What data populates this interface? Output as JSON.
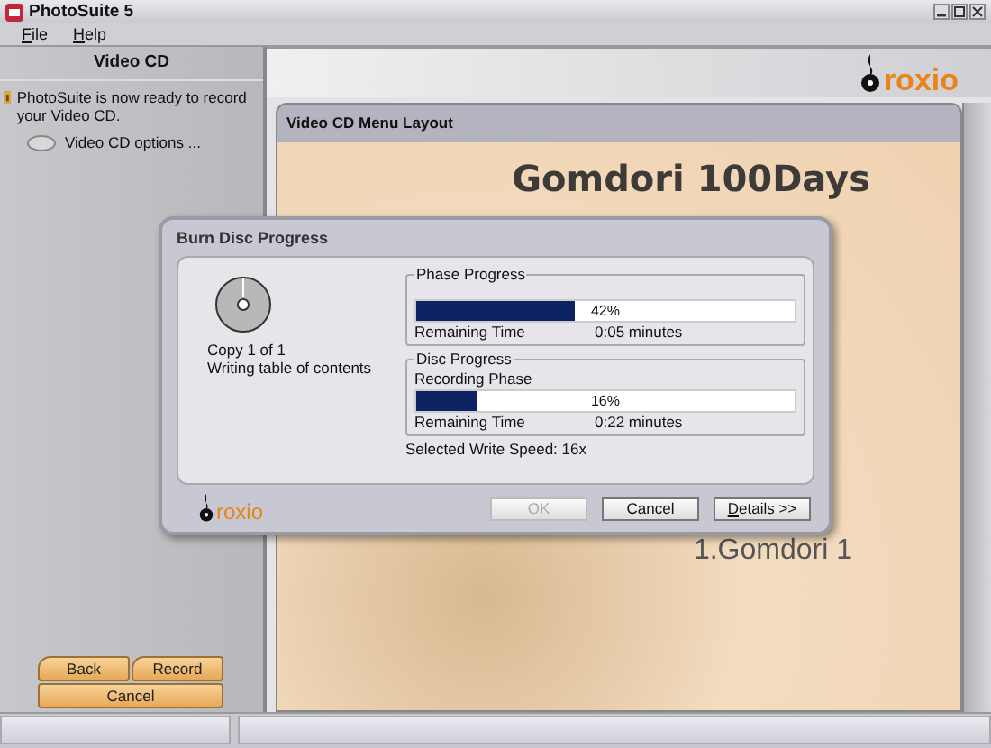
{
  "window": {
    "title": "PhotoSuite 5"
  },
  "menu": [
    "File",
    "Help"
  ],
  "sidebar": {
    "title": "Video CD",
    "message": "PhotoSuite is now ready to record your Video CD.",
    "option": "Video CD options ...",
    "buttons": [
      {
        "label": "Back"
      },
      {
        "label": "Record"
      },
      {
        "label": "Cancel"
      }
    ]
  },
  "header": {
    "logo": "roxio"
  },
  "content": {
    "panel_title": "Video CD Menu Layout",
    "menu_title": "Gomdori 100Days",
    "menu_item": "1.Gomdori 1"
  },
  "dialog": {
    "title": "Burn Disc Progress",
    "copy": "Copy 1 of 1",
    "status": "Writing table of contents",
    "groups": [
      {
        "title": "Phase Progress",
        "level": 0.42,
        "percent": "42%",
        "remaining_label": "Remaining Time",
        "remaining": "0:05 minutes"
      },
      {
        "title": "Disc Progress",
        "subtitle": "Recording Phase",
        "level": 0.16,
        "percent": "16%",
        "remaining_label": "Remaining Time",
        "remaining": "0:22 minutes"
      }
    ],
    "write_speed": "Selected Write Speed: 16x",
    "logo": "roxio",
    "buttons": [
      {
        "label": "OK",
        "disabled": true
      },
      {
        "label": "Cancel",
        "disabled": false
      },
      {
        "label": "Details >>",
        "disabled": false
      }
    ]
  }
}
